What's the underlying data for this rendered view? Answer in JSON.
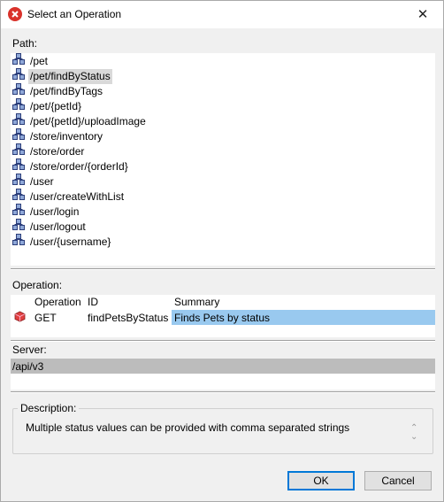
{
  "window": {
    "title": "Select an Operation",
    "close_glyph": "✕"
  },
  "path": {
    "label": "Path:",
    "items": [
      "/pet",
      "/pet/findByStatus",
      "/pet/findByTags",
      "/pet/{petId}",
      "/pet/{petId}/uploadImage",
      "/store/inventory",
      "/store/order",
      "/store/order/{orderId}",
      "/user",
      "/user/createWithList",
      "/user/login",
      "/user/logout",
      "/user/{username}"
    ],
    "selected_index": 1
  },
  "operation": {
    "label": "Operation:",
    "headers": {
      "operation": "Operation",
      "id": "ID",
      "summary": "Summary"
    },
    "rows": [
      {
        "operation": "GET",
        "id": "findPetsByStatus",
        "summary": "Finds Pets by status"
      }
    ]
  },
  "server": {
    "label": "Server:",
    "value": "/api/v3"
  },
  "description": {
    "label": "Description:",
    "text": "Multiple status values can be provided with comma separated strings"
  },
  "buttons": {
    "ok": "OK",
    "cancel": "Cancel"
  },
  "colors": {
    "selection": "#99c9ef",
    "server_highlight": "#bcbcbc",
    "app_icon": "#d9322b"
  }
}
